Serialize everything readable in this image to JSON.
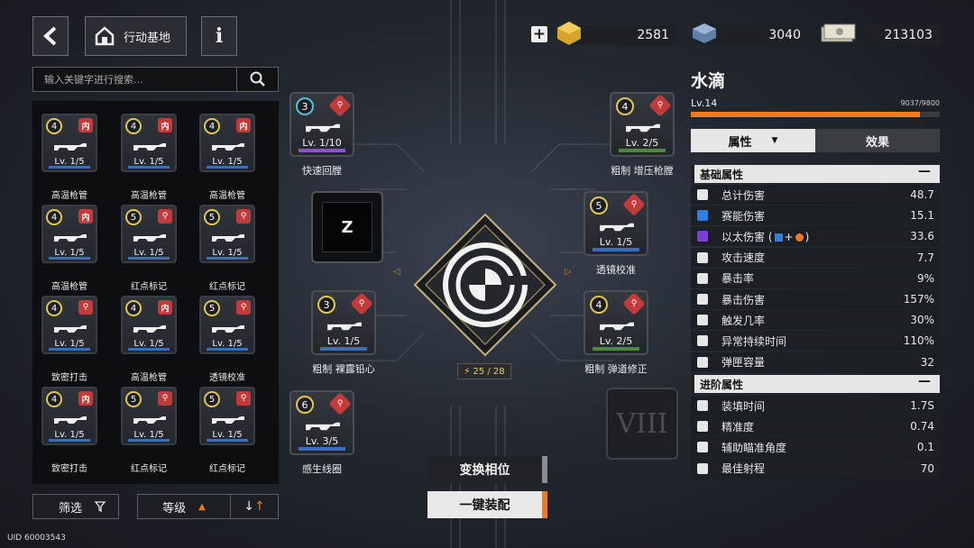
{
  "header": {
    "base_label": "行动基地",
    "info_label": "i"
  },
  "currency": [
    {
      "name": "gold-cube",
      "value": "2581"
    },
    {
      "name": "battery",
      "value": "3040"
    },
    {
      "name": "banknotes",
      "value": "213103"
    }
  ],
  "search": {
    "placeholder": "输入关键字进行搜索..."
  },
  "inventory": [
    {
      "level": "4",
      "badge": "内",
      "lv": "Lv. 1/5",
      "name": "高温枪管"
    },
    {
      "level": "4",
      "badge": "内",
      "lv": "Lv. 1/5",
      "name": "高温枪管"
    },
    {
      "level": "4",
      "badge": "内",
      "lv": "Lv. 1/5",
      "name": "高温枪管"
    },
    {
      "level": "4",
      "badge": "内",
      "lv": "Lv. 1/5",
      "name": "高温枪管"
    },
    {
      "level": "5",
      "badge": "⚲",
      "lv": "Lv. 1/5",
      "name": "红点标记"
    },
    {
      "level": "5",
      "badge": "⚲",
      "lv": "Lv. 1/5",
      "name": "红点标记"
    },
    {
      "level": "4",
      "badge": "⚲",
      "lv": "Lv. 1/5",
      "name": "致密打击"
    },
    {
      "level": "4",
      "badge": "内",
      "lv": "Lv. 1/5",
      "name": "高温枪管"
    },
    {
      "level": "5",
      "badge": "⚲",
      "lv": "Lv. 1/5",
      "name": "透镜校准"
    },
    {
      "level": "4",
      "badge": "内",
      "lv": "Lv. 1/5",
      "name": "致密打击"
    },
    {
      "level": "5",
      "badge": "⚲",
      "lv": "Lv. 1/5",
      "name": "红点标记"
    },
    {
      "level": "5",
      "badge": "⚲",
      "lv": "Lv. 1/5",
      "name": "红点标记"
    }
  ],
  "filters": {
    "filter_label": "筛选",
    "sort_label": "等级"
  },
  "uid": "UID 60003543",
  "slots": {
    "quick_return": {
      "level": "3",
      "lv": "Lv. 1/10",
      "name": "快速回膛"
    },
    "z_slot": {
      "label": "Z"
    },
    "naked_lead": {
      "level": "3",
      "lv": "Lv. 1/5",
      "name": "粗制 裸露铅心"
    },
    "sense_coil": {
      "level": "6",
      "lv": "Lv. 3/5",
      "name": "感生线圈"
    },
    "pressure_chamber": {
      "level": "4",
      "lv": "Lv. 2/5",
      "name": "粗制 增压枪膛"
    },
    "lens_calib": {
      "level": "5",
      "lv": "Lv. 1/5",
      "name": "透镜校准"
    },
    "ballistic_fix": {
      "level": "4",
      "lv": "Lv. 2/5",
      "name": "粗制 弹道修正"
    },
    "viii_slot": {
      "label": "VIII"
    }
  },
  "capacity": {
    "text": "25 / 28"
  },
  "actions": {
    "swap_label": "变换相位",
    "equip_label": "一键装配"
  },
  "weapon": {
    "name": "水滴",
    "level": "Lv.14",
    "exp": "9037/9800",
    "exp_fraction": 0.922
  },
  "tabs": {
    "attr_label": "属性",
    "effect_label": "效果"
  },
  "basic_stats_title": "基础属性",
  "basic_stats": [
    {
      "name": "总计伤害",
      "value": "48.7"
    },
    {
      "name": "赛能伤害",
      "value": "15.1"
    },
    {
      "name": "以太伤害 (",
      "value": "33.6"
    },
    {
      "name": "攻击速度",
      "value": "7.7"
    },
    {
      "name": "暴击率",
      "value": "9%"
    },
    {
      "name": "暴击伤害",
      "value": "157%"
    },
    {
      "name": "触发几率",
      "value": "30%"
    },
    {
      "name": "异常持续时间",
      "value": "110%"
    },
    {
      "name": "弹匣容量",
      "value": "32"
    }
  ],
  "adv_stats_title": "进阶属性",
  "adv_stats": [
    {
      "name": "装填时间",
      "value": "1.7S"
    },
    {
      "name": "精准度",
      "value": "0.74"
    },
    {
      "name": "辅助瞄准角度",
      "value": "0.1"
    },
    {
      "name": "最佳射程",
      "value": "70"
    }
  ],
  "colors": {
    "accent": "#f07a1e",
    "gold": "#e2c64f",
    "badge_red": "#c23b3b"
  }
}
